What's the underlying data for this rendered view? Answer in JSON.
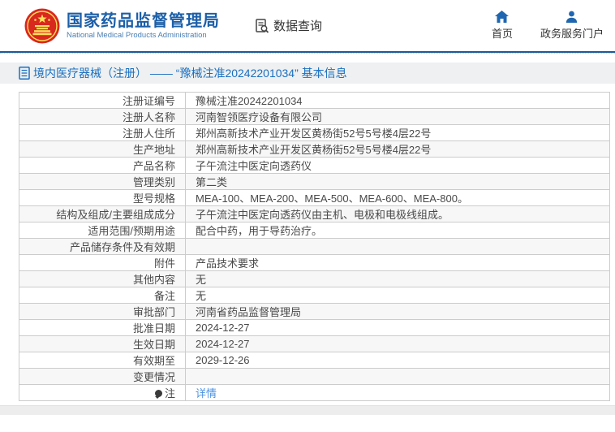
{
  "header": {
    "logo": {
      "emblem_icon": "china-national-emblem-icon",
      "title": "国家药品监督管理局",
      "subtitle": "National Medical Products Administration"
    },
    "data_query_label": "数据查询",
    "nav": [
      {
        "icon": "home-icon",
        "label": "首页"
      },
      {
        "icon": "user-icon",
        "label": "政务服务门户"
      }
    ]
  },
  "breadcrumb": {
    "icon": "document-icon",
    "text": "境内医疗器械（注册） —— “豫械注准20242201034” 基本信息"
  },
  "table": {
    "rows": [
      {
        "label": "注册证编号",
        "value": "豫械注准20242201034"
      },
      {
        "label": "注册人名称",
        "value": "河南智领医疗设备有限公司"
      },
      {
        "label": "注册人住所",
        "value": "郑州高新技术产业开发区黄杨街52号5号楼4层22号"
      },
      {
        "label": "生产地址",
        "value": "郑州高新技术产业开发区黄杨街52号5号楼4层22号"
      },
      {
        "label": "产品名称",
        "value": "子午流注中医定向透药仪"
      },
      {
        "label": "管理类别",
        "value": "第二类"
      },
      {
        "label": "型号规格",
        "value": "MEA-100、MEA-200、MEA-500、MEA-600、MEA-800。"
      },
      {
        "label": "结构及组成/主要组成成分",
        "value": "子午流注中医定向透药仪由主机、电极和电极线组成。"
      },
      {
        "label": "适用范围/预期用途",
        "value": "配合中药，用于导药治疗。"
      },
      {
        "label": "产品储存条件及有效期",
        "value": ""
      },
      {
        "label": "附件",
        "value": "产品技术要求"
      },
      {
        "label": "其他内容",
        "value": "无"
      },
      {
        "label": "备注",
        "value": "无"
      },
      {
        "label": "审批部门",
        "value": "河南省药品监督管理局"
      },
      {
        "label": "批准日期",
        "value": "2024-12-27"
      },
      {
        "label": "生效日期",
        "value": "2024-12-27"
      },
      {
        "label": "有效期至",
        "value": "2029-12-26"
      },
      {
        "label": "变更情况",
        "value": ""
      },
      {
        "label": "注",
        "label_icon": "note-icon",
        "value": "详情",
        "value_is_link": true
      }
    ]
  },
  "colors": {
    "header_blue": "#1c5fa8",
    "header_rule_blue": "#1a5a9c",
    "breadcrumb_blue": "#1a6fc0",
    "link_blue": "#4a90e2",
    "nav_icon_blue": "#1f66b1",
    "emblem_red": "#d9281e",
    "emblem_gold": "#ffde5a",
    "table_border": "#cccccc",
    "alt_row_bg": "#f7f7f7",
    "band_bg": "#eef0f1"
  }
}
